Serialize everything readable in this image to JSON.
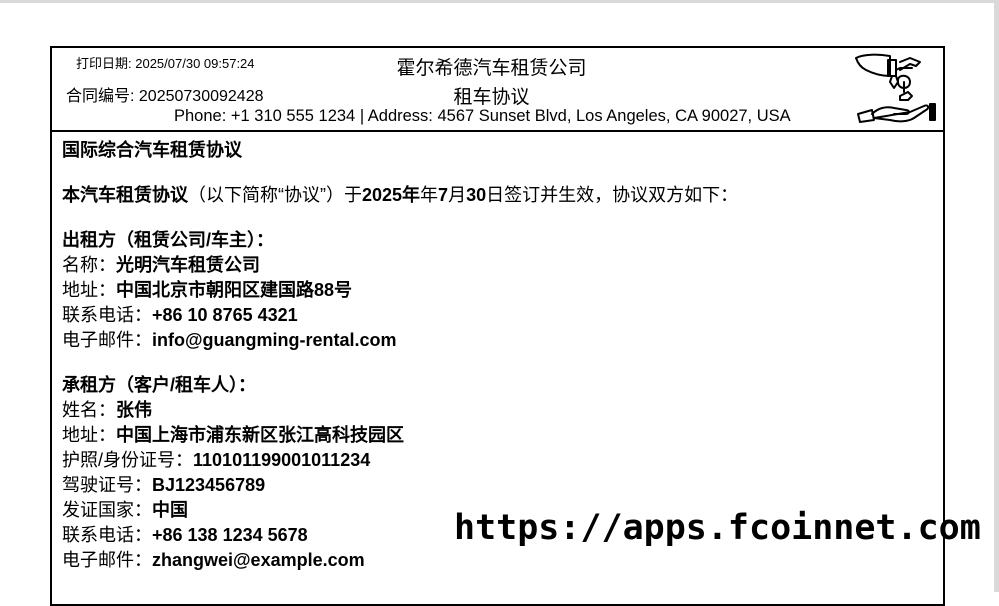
{
  "header": {
    "print_date_label": "打印日期: ",
    "print_date": "2025/07/30 09:57:24",
    "contract_no_label": "合同编号: ",
    "contract_no": "20250730092428",
    "company": "霍尔希德汽车租赁公司",
    "title": "租车协议",
    "phone_label": "Phone: ",
    "phone": "+1 310 555 1234",
    "separator": " | ",
    "address_label": "Address: ",
    "address": "4567 Sunset Blvd, Los Angeles, CA 90027, USA",
    "logo_icon": "car-key-hand-icon"
  },
  "doc": {
    "heading": "国际综合汽车租赁协议",
    "intro_bold": "本汽车租赁协议",
    "intro_mid": "（以下简称“协议”）于",
    "intro_year": "2025年",
    "intro_month_prefix": "年",
    "intro_month": "7",
    "intro_month_suffix": "月",
    "intro_day": "30",
    "intro_end": "日签订并生效，协议双方如下：",
    "lessor": {
      "heading": "出租方（租赁公司/车主）：",
      "name_label": "名称：",
      "name": "光明汽车租赁公司",
      "address_label": "地址：",
      "address": "中国北京市朝阳区建国路88号",
      "phone_label": "联系电话：",
      "phone": "+86 10 8765 4321",
      "email_label": "电子邮件：",
      "email": "info@guangming-rental.com"
    },
    "lessee": {
      "heading": "承租方（客户/租车人）：",
      "name_label": "姓名：",
      "name": "张伟",
      "address_label": "地址：",
      "address": "中国上海市浦东新区张江高科技园区",
      "id_label": "护照/身份证号：",
      "id": "110101199001011234",
      "license_label": "驾驶证号：",
      "license": "BJ123456789",
      "country_label": "发证国家：",
      "country": "中国",
      "phone_label": "联系电话：",
      "phone": "+86 138 1234 5678",
      "email_label": "电子邮件：",
      "email": "zhangwei@example.com"
    }
  },
  "watermark": "https://apps.fcoinnet.com"
}
